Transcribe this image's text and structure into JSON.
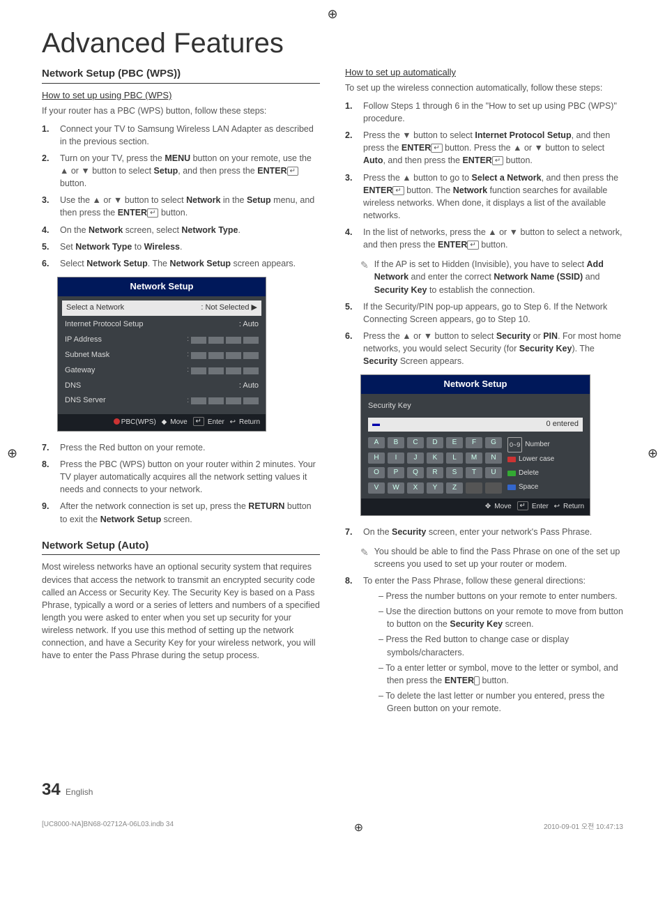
{
  "reg": "⊕",
  "title": "Advanced Features",
  "left": {
    "sec1_head": "Network Setup (PBC (WPS))",
    "sub1": "How to set up using PBC (WPS)",
    "intro1": "If your router has a PBC (WPS) button, follow these steps:",
    "s1": "Connect your TV to Samsung Wireless LAN Adapter as described in the previous section.",
    "s2a": "Turn on your TV, press the ",
    "s2_menu": "MENU",
    "s2b": " button on your remote, use the ▲ or ▼ button to select ",
    "s2_setup": "Setup",
    "s2c": ", and then press the ",
    "s2_enter": "ENTER",
    "s2d": " button.",
    "s3a": "Use the ▲ or ▼ button to select ",
    "s3_net": "Network",
    "s3b": " in the ",
    "s3_setup": "Setup",
    "s3c": " menu, and then press the ",
    "s3_enter": "ENTER",
    "s3d": " button.",
    "s4a": "On the ",
    "s4_net": "Network",
    "s4b": " screen, select ",
    "s4_nt": "Network Type",
    "s4c": ".",
    "s5a": "Set ",
    "s5_nt": "Network Type",
    "s5b": " to ",
    "s5_w": "Wireless",
    "s5c": ".",
    "s6a": "Select ",
    "s6_ns": "Network Setup",
    "s6b": ". The ",
    "s6_ns2": "Network Setup",
    "s6c": " screen appears.",
    "s7": "Press the Red button on your remote.",
    "s8": "Press the PBC (WPS) button on your router within 2 minutes. Your TV player automatically acquires all the network setting values it needs and connects to your network.",
    "s9a": "After the network connection is set up, press the ",
    "s9_ret": "RETURN",
    "s9b": " button to exit the ",
    "s9_ns": "Network Setup",
    "s9c": " screen.",
    "panel1": {
      "title": "Network Setup",
      "r1l": "Select a Network",
      "r1v": ": Not Selected  ▶",
      "r2l": "Internet Protocol Setup",
      "r2v": ": Auto",
      "r3l": "IP Address",
      "r4l": "Subnet Mask",
      "r5l": "Gateway",
      "r6l": "DNS",
      "r6v": ": Auto",
      "r7l": "DNS Server",
      "f_pbc": "PBC(WPS)",
      "f_move": "Move",
      "f_enter": "Enter",
      "f_return": "Return"
    },
    "sec2_head": "Network Setup (Auto)",
    "auto_para": "Most wireless networks have an optional security system that requires devices that access the network to transmit an encrypted security code called an Access or Security Key. The Security Key is based on a Pass Phrase, typically a word or a series of letters and numbers of a specified length you were asked to enter when you set up security for your wireless network.  If you use this method of setting up the network connection, and have a Security Key for your wireless network, you will have to enter the Pass Phrase during the setup process."
  },
  "right": {
    "sub1": "How to set up automatically",
    "intro1": "To set up the wireless connection automatically, follow these steps:",
    "s1": "Follow Steps 1 through 6 in the \"How to set up using PBC (WPS)\" procedure.",
    "s2a": "Press the ▼ button to select ",
    "s2_ips": "Internet Protocol Setup",
    "s2b": ", and then press the ",
    "s2_enter": "ENTER",
    "s2c": " button. Press the ▲ or ▼ button to select ",
    "s2_auto": "Auto",
    "s2d": ", and then press the ",
    "s2_enter2": "ENTER",
    "s2e": " button.",
    "s3a": "Press the ▲ button to go to ",
    "s3_sel": "Select a Network",
    "s3b": ", and then press the ",
    "s3_enter": "ENTER",
    "s3c": " button. The ",
    "s3_net": "Network",
    "s3d": " function searches for available wireless networks. When done, it displays a list of the available networks.",
    "s4a": "In the list of networks, press the ▲ or ▼ button to select a network, and then press the ",
    "s4_enter": "ENTER",
    "s4b": " button.",
    "note1a": "If the AP is set to Hidden (Invisible), you have to select ",
    "note1_add": "Add Network",
    "note1b": " and enter the correct ",
    "note1_ssid": "Network Name (SSID)",
    "note1c": " and ",
    "note1_sk": "Security Key",
    "note1d": " to establish the connection.",
    "s5": "If the Security/PIN pop-up appears, go to Step 6. If the Network Connecting Screen appears, go to Step 10.",
    "s6a": "Press the ▲ or ▼ button to select ",
    "s6_sec": "Security",
    "s6b": " or ",
    "s6_pin": "PIN",
    "s6c": ". For most home networks, you would select Security (for ",
    "s6_sk": "Security Key",
    "s6d": "). The ",
    "s6_sec2": "Security",
    "s6e": " Screen appears.",
    "panel2": {
      "title": "Network Setup",
      "seclabel": "Security Key",
      "entered": "0 entered",
      "keys": [
        "A",
        "B",
        "C",
        "D",
        "E",
        "F",
        "G",
        "H",
        "I",
        "J",
        "K",
        "L",
        "M",
        "N",
        "O",
        "P",
        "Q",
        "R",
        "S",
        "T",
        "U",
        "V",
        "W",
        "X",
        "Y",
        "Z",
        "",
        ""
      ],
      "lg_num": "Number",
      "lg_lower": "Lower case",
      "lg_del": "Delete",
      "lg_space": "Space",
      "f_move": "Move",
      "f_enter": "Enter",
      "f_return": "Return"
    },
    "s7a": "On the ",
    "s7_sec": "Security",
    "s7b": " screen, enter your network's Pass Phrase.",
    "note2": "You should be able to find the Pass Phrase on one of the set up screens you used to set up your router or modem.",
    "s8": "To enter the Pass Phrase, follow these general directions:",
    "d1": "Press the number buttons on your remote to enter numbers.",
    "d2a": "Use the direction buttons on your remote to move from button to button on the ",
    "d2_sk": "Security Key",
    "d2b": " screen.",
    "d3": "Press the Red button to change case or display symbols/characters.",
    "d4a": "To a enter letter or symbol, move to the letter or symbol, and then press the ",
    "d4_enter": "ENTER",
    "d4b": " button.",
    "d5": "To delete the last letter or number you entered, press the Green button on your remote."
  },
  "footer": {
    "pn": "34",
    "lang": "English",
    "file": "[UC8000-NA]BN68-02712A-06L03.indb   34",
    "date": "2010-09-01   오전 10:47:13"
  }
}
